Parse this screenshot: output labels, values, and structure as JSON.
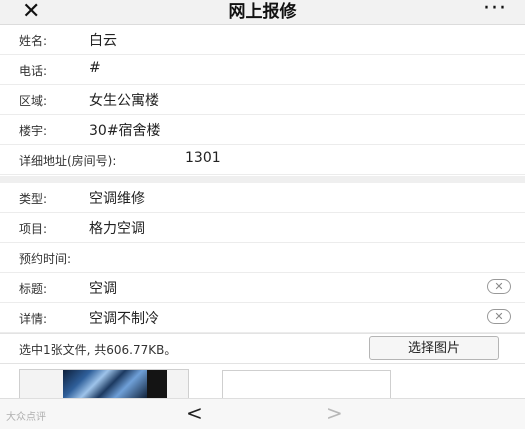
{
  "header": {
    "close_icon": "✕",
    "title": "网上报修",
    "more_icon": "···"
  },
  "fields": [
    {
      "label": "姓名:",
      "value": "白云"
    },
    {
      "label": "电话:",
      "value": "#"
    },
    {
      "label": "区域:",
      "value": "女生公寓楼"
    },
    {
      "label": "楼宇:",
      "value": "30#宿舍楼"
    },
    {
      "label": "详细地址(房间号):",
      "value": "1301"
    },
    {
      "label": "类型:",
      "value": "空调维修"
    },
    {
      "label": "项目:",
      "value": "格力空调"
    },
    {
      "label": "预约时间:",
      "value": ""
    },
    {
      "label": "标题:",
      "value": "空调"
    },
    {
      "label": "详情:",
      "value": "空调不制冷"
    }
  ],
  "clear_icon": "✕",
  "upload": {
    "info": "选中1张文件, 共606.77KB。",
    "button": "选择图片"
  },
  "nav": {
    "back": "<",
    "forward": ">",
    "watermark": "大众点评"
  }
}
